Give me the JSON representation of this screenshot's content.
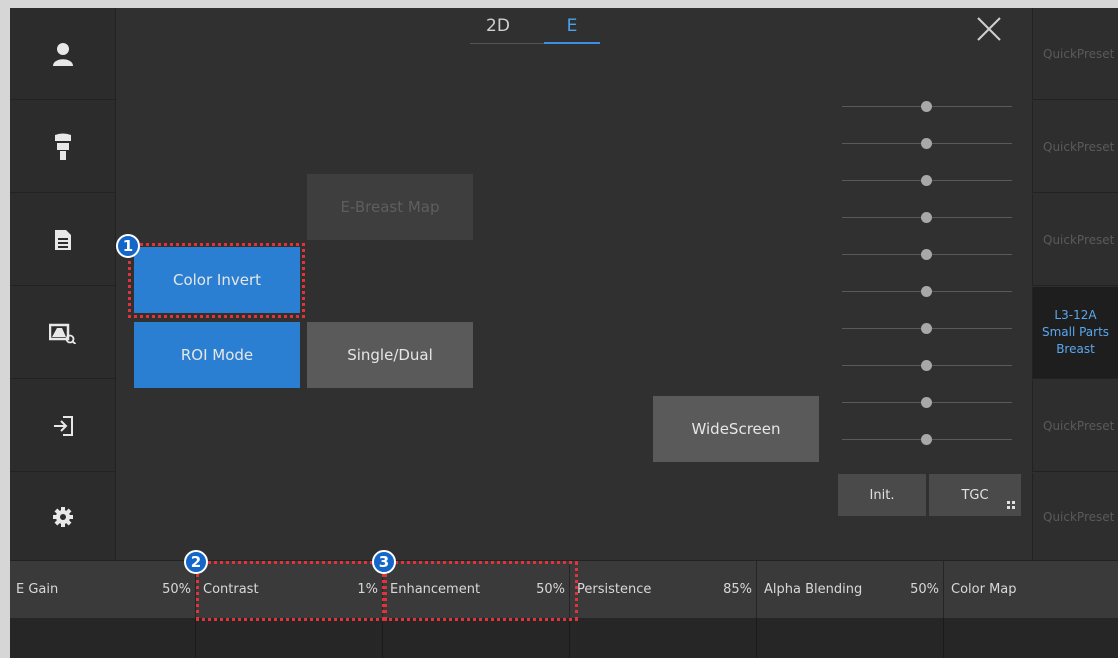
{
  "tabs": [
    {
      "label": "2D",
      "active": false
    },
    {
      "label": "E",
      "active": true
    }
  ],
  "sidebar": {
    "items": [
      {
        "icon": "user-icon"
      },
      {
        "icon": "probe-icon"
      },
      {
        "icon": "document-icon"
      },
      {
        "icon": "image-review-icon"
      },
      {
        "icon": "exit-icon"
      },
      {
        "icon": "gear-icon"
      }
    ]
  },
  "buttons": {
    "e_breast_map": "E-Breast Map",
    "color_invert": "Color Invert",
    "roi_mode": "ROI Mode",
    "single_dual": "Single/Dual",
    "widescreen": "WideScreen",
    "init": "Init.",
    "tgc": "TGC"
  },
  "presets": [
    {
      "label": "QuickPreset"
    },
    {
      "label": "QuickPreset"
    },
    {
      "label": "QuickPreset"
    },
    {
      "label": "L3-12A\nSmall Parts\nBreast",
      "line1": "L3-12A",
      "line2": "Small Parts",
      "line3": "Breast",
      "active": true
    },
    {
      "label": "QuickPreset"
    },
    {
      "label": "QuickPreset"
    }
  ],
  "params": [
    {
      "name": "E Gain",
      "value": "50%"
    },
    {
      "name": "Contrast",
      "value": "1%"
    },
    {
      "name": "Enhancement",
      "value": "50%"
    },
    {
      "name": "Persistence",
      "value": "85%"
    },
    {
      "name": "Alpha Blending",
      "value": "50%"
    },
    {
      "name": "Color Map",
      "value": ""
    }
  ],
  "callouts": [
    {
      "number": "1"
    },
    {
      "number": "2"
    },
    {
      "number": "3"
    }
  ],
  "colors": {
    "accent": "#2b7fd2",
    "active_tab": "#4aa3f0",
    "callout": "#e0333a",
    "badge": "#1466c8"
  }
}
